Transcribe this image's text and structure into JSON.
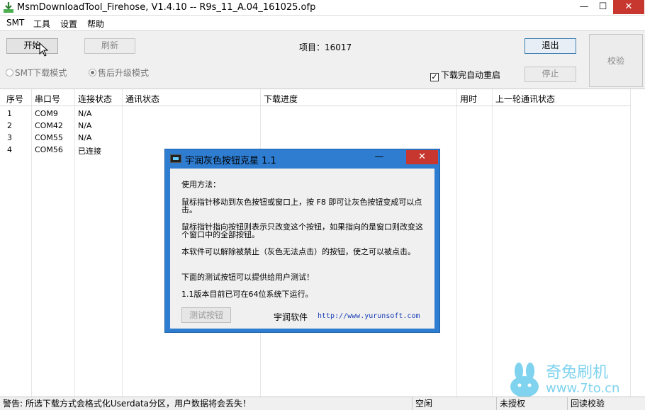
{
  "window": {
    "title": "MsmDownloadTool_Firehose, V1.4.10 -- R9s_11_A.04_161025.ofp",
    "min_glyph": "—",
    "max_glyph": "☐",
    "close_glyph": "✕"
  },
  "menu": {
    "items": [
      "SMT",
      "工具",
      "设置",
      "帮助"
    ]
  },
  "toolbar": {
    "start_label": "开始",
    "refresh_label": "刷新",
    "project_label": "项目：16017",
    "exit_label": "退出",
    "stop_label": "停止",
    "verify_label": "校验",
    "radio_smt_label": "SMT下载模式",
    "radio_sale_label": "售后升级模式",
    "auto_restart_label": "下载完自动重启",
    "check_glyph": "✓"
  },
  "table": {
    "headers": [
      "序号",
      "串口号",
      "连接状态",
      "通讯状态",
      "下载进度",
      "用时",
      "上一轮通讯状态"
    ],
    "rows": [
      {
        "index": "1",
        "port": "COM9",
        "connection": "N/A"
      },
      {
        "index": "2",
        "port": "COM42",
        "connection": "N/A"
      },
      {
        "index": "3",
        "port": "COM55",
        "connection": "N/A"
      },
      {
        "index": "4",
        "port": "COM56",
        "connection": "已连接"
      }
    ]
  },
  "watermark": {
    "brand": "奇兔刷机",
    "url": "www.7to.cn"
  },
  "statusbar": {
    "warning": "警告: 所选下载方式会格式化Userdata分区，用户数据将会丢失！",
    "status": "空闲",
    "license": "未授权",
    "readback": "回读校验"
  },
  "dialog": {
    "title": "宇润灰色按钮克星 1.1",
    "min_glyph": "—",
    "close_glyph": "✕",
    "usage_heading": "使用方法：",
    "para1": "鼠标指针移动到灰色按钮或窗口上，按 F8 即可让灰色按钮变成可以点击。",
    "para2": "鼠标指针指向按钮则表示只改变这个按钮，如果指向的是窗口则改变这个窗口中的全部按钮。",
    "para3": "本软件可以解除被禁止（灰色无法点击）的按钮，使之可以被点击。",
    "para4": "下面的测试按钮可以提供给用户测试！",
    "para5": "1.1版本目前已可在64位系统下运行。",
    "test_button_label": "测试按钮",
    "brand": "宇润软件",
    "url": "http://www.yurunsoft.com"
  }
}
